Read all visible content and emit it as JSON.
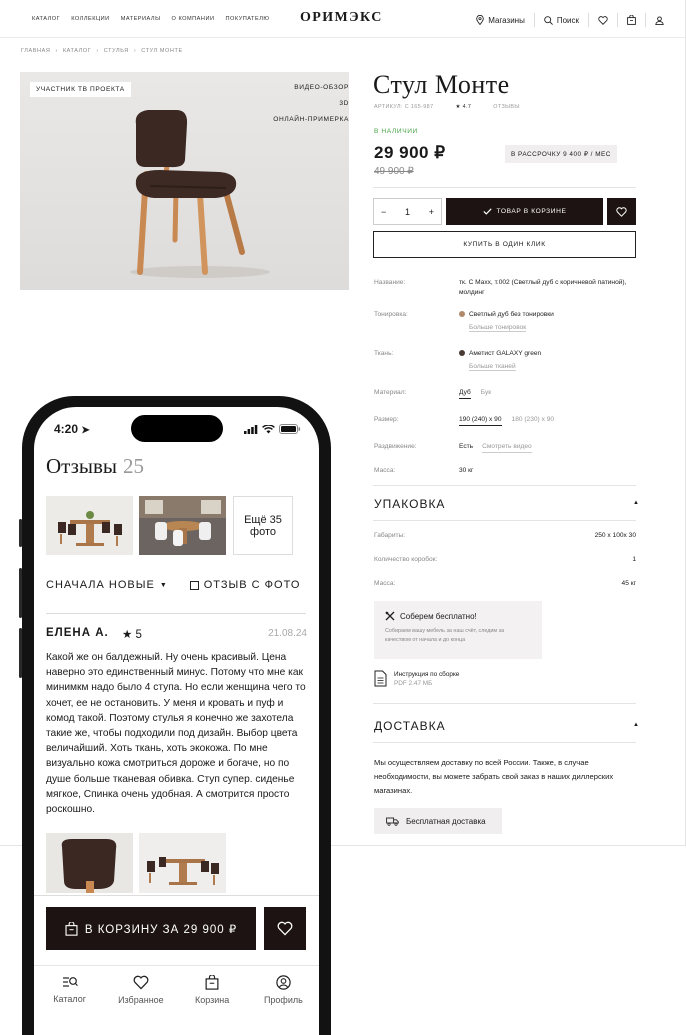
{
  "header": {
    "nav": [
      {
        "label": "Каталог",
        "icon": "grid-icon"
      },
      {
        "label": "Коллекции"
      },
      {
        "label": "Материалы"
      },
      {
        "label": "О компании"
      },
      {
        "label": "Покупателю"
      }
    ],
    "logo": "ОРИМЭКС",
    "stores": "Магазины",
    "search": "Поиск"
  },
  "breadcrumbs": [
    "ГЛАВНАЯ",
    "КАТАЛОГ",
    "СТУЛЬЯ",
    "СТУЛ МОНТЕ"
  ],
  "photo": {
    "badge": "УЧАСТНИК ТВ ПРОЕКТА",
    "flags": [
      "ВИДЕО-ОБЗОР",
      "3D",
      "ОНЛАЙН-ПРИМЕРКА"
    ]
  },
  "product": {
    "title": "Стул Монте",
    "article": "АРТИКУЛ: С 165-987",
    "rating": "★ 4.7",
    "reviews": "ОТЗЫВЫ",
    "stock": "В НАЛИЧИИ",
    "price": "29 900 ₽",
    "old_price": "49 900 ₽",
    "installment": "В РАССРОЧКУ 9 400 ₽ / МЕС",
    "qty": "1",
    "qty_minus": "−",
    "qty_plus": "+",
    "in_cart": "ТОВАР В КОРЗИНЕ",
    "one_click": "КУПИТЬ В ОДИН КЛИК"
  },
  "attributes": {
    "name_label": "Название:",
    "name_value": "тк. С Maxx, т.002 (Светлый дуб с коричневой патиной), молдинг",
    "toning_label": "Тонировка:",
    "toning_value": "Светлый дуб без тонировки",
    "toning_more": "Больше тонировок",
    "toning_color": "#b08a6a",
    "fabric_label": "Ткань:",
    "fabric_value": "Аметист GALAXY green",
    "fabric_more": "Больше тканей",
    "fabric_color": "#4a3a34",
    "material_label": "Материал:",
    "material_options": [
      "Дуб",
      "Бук"
    ],
    "size_label": "Размер:",
    "size_options": [
      "190 (240) x 90",
      "180 (230) x 90"
    ],
    "extend_label": "Раздвижение:",
    "extend_value": "Есть",
    "extend_video": "Смотреть видео",
    "mass_label": "Масса:",
    "mass_value": "30 кг"
  },
  "packing": {
    "title": "УПАКОВКА",
    "rows": [
      {
        "k": "Габариты:",
        "v": "250 x 100x 30"
      },
      {
        "k": "Количество коробок:",
        "v": "1"
      },
      {
        "k": "Масса:",
        "v": "45 кг"
      }
    ],
    "assembly_title": "Соберем бесплатно!",
    "assembly_text": "Собираем вашу мебель за наш счёт, следим за качеством от начала и до конца",
    "instr_title": "Инструкция по сборке",
    "instr_file": "PDF 2.47 МБ"
  },
  "delivery": {
    "title": "ДОСТАВКА",
    "text": "Мы осуществляем доставку по всей России. Также, в случае необходимости, вы можете забрать свой заказ в наших диллерских магазинах.",
    "free": "Бесплатная доставка"
  },
  "phone": {
    "time": "4:20",
    "reviews_title": "Отзывы",
    "reviews_count": "25",
    "more_photos": "Ещё 35 фото",
    "sort": "СНАЧАЛА НОВЫЕ",
    "with_photo": "ОТЗЫВ С ФОТО",
    "review": {
      "author": "ЕЛЕНА А.",
      "rating": "★ 5",
      "date": "21.08.24",
      "text": "Какой же он балдежный. Ну очень красивый. Цена наверно это единственный минус. Потому что мне как минимкм надо было 4 ступа. Но если женщина чего то хочет, ее не остановить. У меня и кровать и пуф и комод такой. Поэтому стулья я конечно же захотела такие же, чтобы подходили под дизайн. Выбор цвета величайший. Хоть ткань, хоть экокожа. По мне визуально кожа смотриться дороже и богаче, но по душе больше тканевая обивка. Ступ супер. сиденье мягкое, Спинка очень удобная. А смотрится просто роскошно."
    },
    "cart_button": "В КОРЗИНУ ЗА 29 900 ₽",
    "tabs": [
      {
        "label": "Каталог"
      },
      {
        "label": "Избранное"
      },
      {
        "label": "Корзина"
      },
      {
        "label": "Профиль"
      }
    ]
  }
}
